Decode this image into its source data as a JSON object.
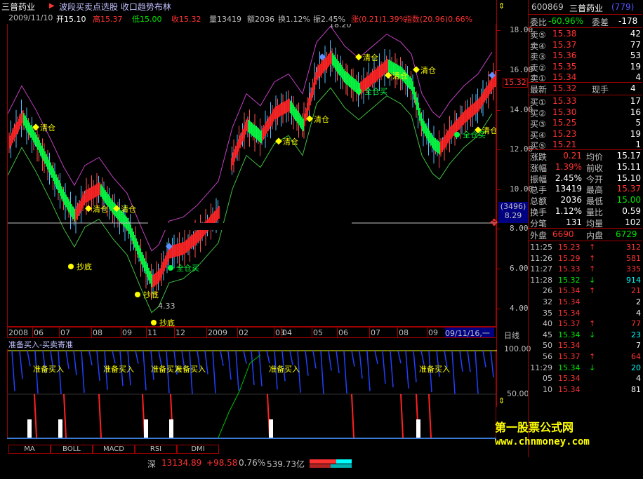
{
  "header": {
    "stock_name": "三普药业",
    "indicator_name": "波段买卖点选股 收口趋势布林"
  },
  "quote_line": {
    "date": "2009/11/10",
    "open": "开15.10",
    "high": "高15.37",
    "low": "低15.00",
    "close": "收15.32",
    "volume": "量13419",
    "amount": "额2036",
    "turnover": "换1.12%",
    "amplitude": "振2.45%",
    "change": "涨(0.21)1.39%",
    "index": "指数(20.96)0.66%"
  },
  "price_axis": {
    "ticks": [
      "18.00",
      "16.00",
      "14.00",
      "12.00",
      "10.00",
      "8.00",
      "6.00",
      "4.00"
    ],
    "current_price_tag": "15.32",
    "cursor_label_top": "(3496)",
    "cursor_label_bottom": "8.29",
    "sub_ticks": [
      "100.00",
      "50.00"
    ],
    "unit_label": "日线"
  },
  "annotations": {
    "max_price": "18.20",
    "min_price": "4.33",
    "qingcang": "清仓",
    "chaodi": "抄底",
    "zhunbei": "准备买入",
    "quanmai": "全仓买"
  },
  "time_axis": {
    "labels": [
      "2008",
      "06",
      "07",
      "08",
      "09",
      "11",
      "12",
      "2009",
      "02",
      "03",
      "04",
      "05",
      "06",
      "07",
      "08",
      "09"
    ],
    "cursor_date": "09/11/16,一"
  },
  "sub_indicator": {
    "title": "准备买入-买卖寄准"
  },
  "tabs": [
    "MA",
    "BOLL",
    "MACD",
    "RSI",
    "DMI"
  ],
  "status_bar": {
    "market": "深",
    "index_value": "13134.89",
    "index_change": "+98.58",
    "index_pct": "0.76%",
    "index_amount": "539.73亿"
  },
  "right_panel": {
    "code": "600869",
    "name": "三普药业",
    "code_extra": "(779)",
    "weibi_label": "委比",
    "weibi_value": "-60.96%",
    "weicha_label": "委差",
    "weicha_value": "-178",
    "asks": [
      {
        "label": "卖⑤",
        "price": "15.38",
        "vol": "42"
      },
      {
        "label": "卖④",
        "price": "15.37",
        "vol": "77"
      },
      {
        "label": "卖③",
        "price": "15.36",
        "vol": "53"
      },
      {
        "label": "卖②",
        "price": "15.35",
        "vol": "19"
      },
      {
        "label": "卖①",
        "price": "15.34",
        "vol": "4"
      }
    ],
    "last_label": "最新",
    "last_price": "15.32",
    "xianshou_label": "现手",
    "xianshou_value": "4",
    "bids": [
      {
        "label": "买①",
        "price": "15.33",
        "vol": "17"
      },
      {
        "label": "买②",
        "price": "15.30",
        "vol": "16"
      },
      {
        "label": "买③",
        "price": "15.25",
        "vol": "5"
      },
      {
        "label": "买④",
        "price": "15.23",
        "vol": "19"
      },
      {
        "label": "买⑤",
        "price": "15.21",
        "vol": "1"
      }
    ],
    "stats": [
      {
        "l1": "涨跌",
        "v1": "0.21",
        "l2": "均价",
        "v2": "15.17"
      },
      {
        "l1": "涨幅",
        "v1": "1.39%",
        "l2": "前收",
        "v2": "15.11"
      },
      {
        "l1": "振幅",
        "v1": "2.45%",
        "l2": "今开",
        "v2": "15.10"
      },
      {
        "l1": "总手",
        "v1": "13419",
        "l2": "最高",
        "v2": "15.37"
      },
      {
        "l1": "总额",
        "v1": "2036",
        "l2": "最低",
        "v2": "15.00"
      },
      {
        "l1": "换手",
        "v1": "1.12%",
        "l2": "量比",
        "v2": "0.59"
      },
      {
        "l1": "分笔",
        "v1": "131",
        "l2": "均量",
        "v2": "102"
      }
    ],
    "waipan_label": "外盘",
    "waipan_value": "6690",
    "neipan_label": "内盘",
    "neipan_value": "6729",
    "ticks": [
      {
        "time": "11:25",
        "price": "15.23",
        "dir": "↑",
        "vol": "312"
      },
      {
        "time": "11:26",
        "price": "15.29",
        "dir": "↑",
        "vol": "581"
      },
      {
        "time": "11:27",
        "price": "15.33",
        "dir": "↑",
        "vol": "335"
      },
      {
        "time": "11:28",
        "price": "15.32",
        "dir": "↓",
        "vol": "914"
      },
      {
        "time": "26",
        "price": "15.34",
        "dir": "↑",
        "vol": "21"
      },
      {
        "time": "32",
        "price": "15.34",
        "dir": "",
        "vol": "2"
      },
      {
        "time": "35",
        "price": "15.34",
        "dir": "",
        "vol": "4"
      },
      {
        "time": "40",
        "price": "15.37",
        "dir": "↑",
        "vol": "77"
      },
      {
        "time": "45",
        "price": "15.34",
        "dir": "↓",
        "vol": "23"
      },
      {
        "time": "50",
        "price": "15.34",
        "dir": "",
        "vol": "7"
      },
      {
        "time": "56",
        "price": "15.37",
        "dir": "↑",
        "vol": "64"
      },
      {
        "time": "11:29",
        "price": "15.34",
        "dir": "↓",
        "vol": "20"
      },
      {
        "time": "05",
        "price": "15.34",
        "dir": "",
        "vol": "4"
      },
      {
        "time": "10",
        "price": "15.34",
        "dir": "",
        "vol": "81"
      }
    ]
  },
  "watermark": {
    "line1": "第一股票公式网",
    "line2": "www.chnmoney.com"
  }
}
